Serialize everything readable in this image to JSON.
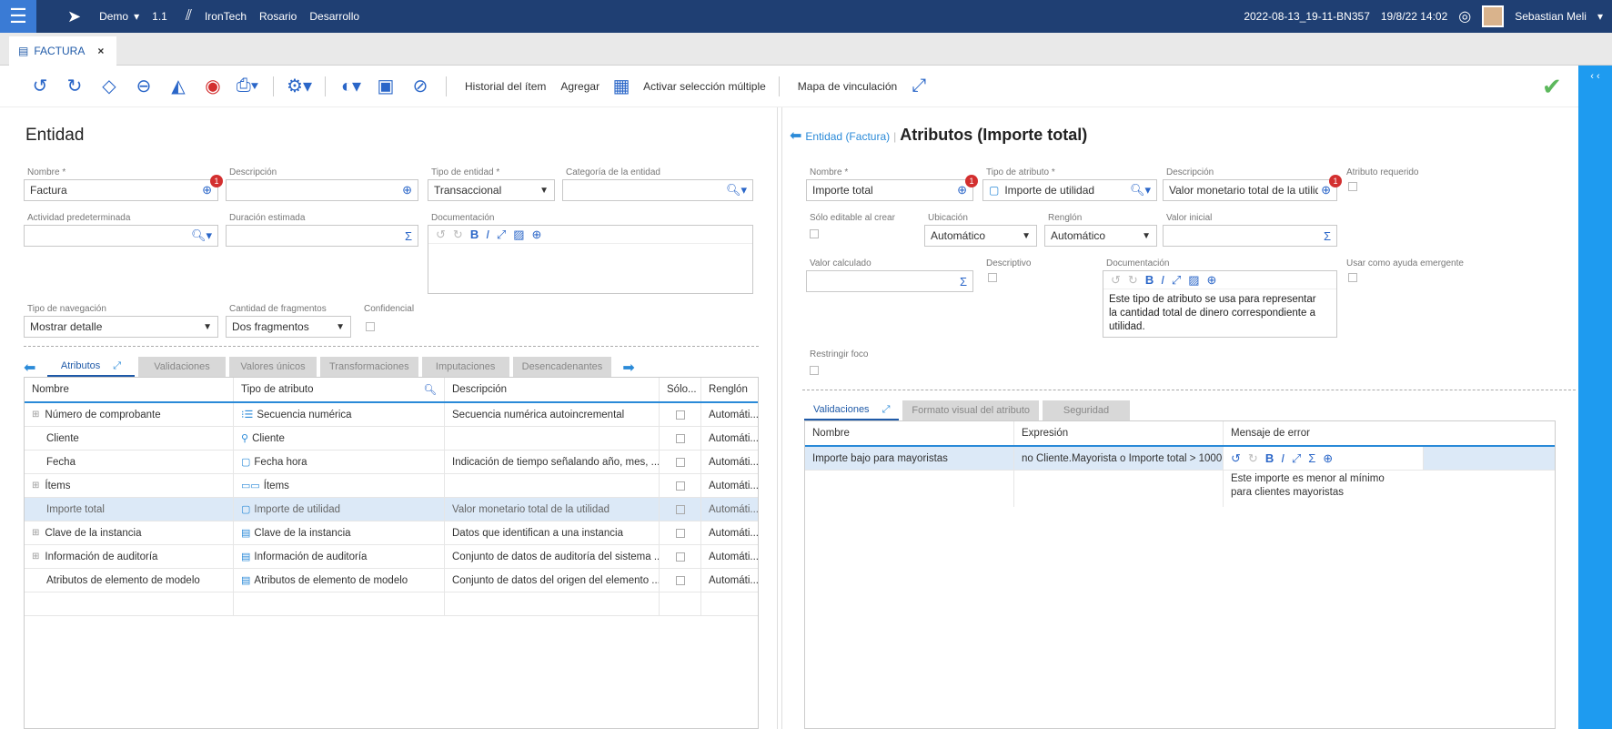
{
  "topbar": {
    "env": "Demo",
    "version": "1.1",
    "org": "IronTech",
    "site": "Rosario",
    "stage": "Desarrollo",
    "build": "2022-08-13_19-11-BN357",
    "datetime": "19/8/22 14:02",
    "user": "Sebastian Meli"
  },
  "tab": {
    "label": "FACTURA",
    "close": "×"
  },
  "toolbar": {
    "history": "Historial del ítem",
    "add": "Agregar",
    "multi": "Activar selección múltiple",
    "map": "Mapa de vinculación"
  },
  "entity": {
    "title": "Entidad",
    "name_label": "Nombre *",
    "name_value": "Factura",
    "desc_label": "Descripción",
    "type_label": "Tipo de entidad *",
    "type_value": "Transaccional",
    "category_label": "Categoría de la entidad",
    "activity_label": "Actividad predeterminada",
    "duration_label": "Duración estimada",
    "doc_label": "Documentación",
    "nav_label": "Tipo de navegación",
    "nav_value": "Mostrar detalle",
    "frag_label": "Cantidad de fragmentos",
    "frag_value": "Dos fragmentos",
    "conf_label": "Confidencial",
    "badge": "1"
  },
  "left_tabs": [
    "Atributos",
    "Validaciones",
    "Valores únicos",
    "Transformaciones",
    "Imputaciones",
    "Desencadenantes"
  ],
  "attr_grid": {
    "headers": [
      "Nombre",
      "Tipo de atributo",
      "Descripción",
      "Sólo...",
      "Renglón"
    ],
    "rows": [
      {
        "name": "Número de comprobante",
        "type": "Secuencia numérica",
        "desc": "Secuencia numérica autoincremental",
        "row": "Automáti..."
      },
      {
        "name": "Cliente",
        "type": "Cliente",
        "desc": "",
        "row": "Automáti..."
      },
      {
        "name": "Fecha",
        "type": "Fecha hora",
        "desc": "Indicación de tiempo señalando año, mes, ...",
        "row": "Automáti..."
      },
      {
        "name": "Ítems",
        "type": "Ítems",
        "desc": "",
        "row": "Automáti..."
      },
      {
        "name": "Importe total",
        "type": "Importe de utilidad",
        "desc": "Valor monetario total de la utilidad",
        "row": "Automáti..."
      },
      {
        "name": "Clave de la instancia",
        "type": "Clave de la instancia",
        "desc": "Datos que identifican a una instancia",
        "row": "Automáti..."
      },
      {
        "name": "Información de auditoría",
        "type": "Información de auditoría",
        "desc": "Conjunto de datos de auditoría del sistema ...",
        "row": "Automáti..."
      },
      {
        "name": "Atributos de elemento de modelo",
        "type": "Atributos de elemento de modelo",
        "desc": "Conjunto de datos del origen del elemento ...",
        "row": "Automáti..."
      }
    ]
  },
  "attr": {
    "crumb": "Entidad (Factura)",
    "title": "Atributos (Importe total)",
    "name_label": "Nombre *",
    "name_value": "Importe total",
    "type_label": "Tipo de atributo *",
    "type_value": "Importe de utilidad",
    "desc_label": "Descripción",
    "desc_value": "Valor monetario total de la utilidad",
    "req_label": "Atributo requerido",
    "editable_label": "Sólo editable al crear",
    "loc_label": "Ubicación",
    "loc_value": "Automático",
    "row_label": "Renglón",
    "row_value": "Automático",
    "init_label": "Valor inicial",
    "calc_label": "Valor calculado",
    "descr_label": "Descriptivo",
    "doc_label": "Documentación",
    "doc_text": "Este tipo de atributo se usa para representar la cantidad total de dinero correspondiente a utilidad.",
    "help_label": "Usar como ayuda emergente",
    "focus_label": "Restringir foco"
  },
  "right_tabs": [
    "Validaciones",
    "Formato visual del atributo",
    "Seguridad"
  ],
  "val_grid": {
    "headers": [
      "Nombre",
      "Expresión",
      "Mensaje de error"
    ],
    "row_name": "Importe bajo para mayoristas",
    "row_expr": "no Cliente.Mayorista o Importe total > 1000",
    "row_msg": "Este importe es menor  al mínimo para clientes mayoristas"
  }
}
